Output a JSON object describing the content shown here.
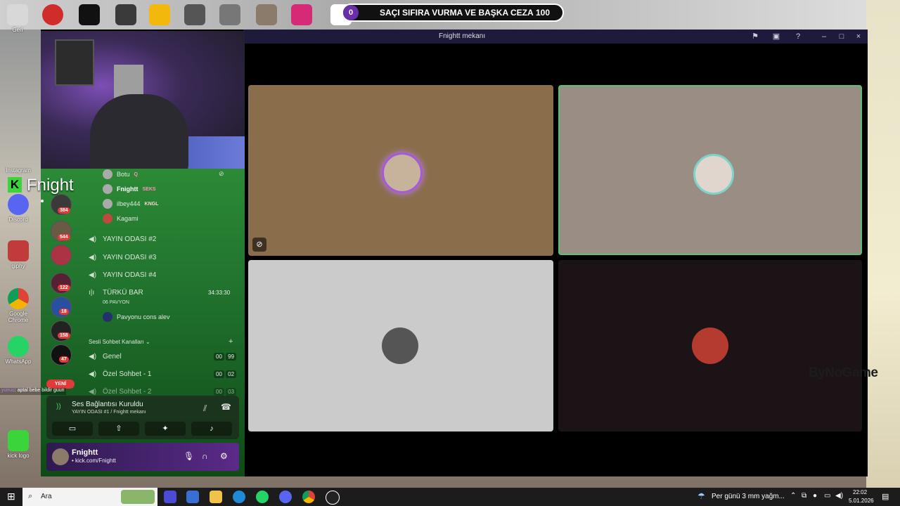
{
  "desktop": {
    "top_icons": [
      "Geri",
      "Instagram"
    ],
    "left_icons": [
      {
        "label": "Instagram",
        "icon": "instagram-icon"
      },
      {
        "label": "Discord",
        "icon": "discord-icon"
      },
      {
        "label": "giphy",
        "icon": "giphy-icon"
      },
      {
        "label": "Google Chrome",
        "icon": "chrome-icon"
      },
      {
        "label": "WhatsApp",
        "icon": "whatsapp-icon"
      },
      {
        "label": "kick logo",
        "icon": "kick-icon"
      }
    ]
  },
  "goal": {
    "current": "0",
    "text": "SAÇI SIFIRA VURMA VE BAŞKA CEZA",
    "target": "100"
  },
  "stream_overlay": {
    "channel_name": "Fnight",
    "sponsor": "ByNoGame"
  },
  "chat": {
    "user": "yunus",
    "message": ": aptal bebe bildir guun"
  },
  "discord_window": {
    "title": "Fnightt mekanı",
    "title_icons": [
      "flag-icon",
      "popout-icon",
      "help-icon",
      "minimize-icon",
      "maximize-icon",
      "close-icon"
    ]
  },
  "server_list": {
    "badges": [
      "384",
      "544",
      "122",
      "18",
      "158",
      "47"
    ],
    "new_label": "YENİ"
  },
  "voice_members": [
    {
      "name": "Botu",
      "tag": "Q"
    },
    {
      "name": "Fnightt",
      "tag": "SEKS"
    },
    {
      "name": "ilbey444",
      "tag": "KNGL"
    },
    {
      "name": "Kagami",
      "tag": ""
    }
  ],
  "channels": {
    "yayin": [
      "YAYIN ODASI #2",
      "YAYIN ODASI #3",
      "YAYIN ODASI #4"
    ],
    "turku_bar": {
      "name": "TÜRKÜ BAR",
      "timer": "34:33:30",
      "sub": "06 PAVYON",
      "member": "Pavyonu cons alev"
    },
    "category": "Sesli Sohbet Kanalları",
    "sesli": [
      {
        "name": "Genel",
        "a": "00",
        "b": "99"
      },
      {
        "name": "Özel Sohbet - 1",
        "a": "00",
        "b": "02"
      },
      {
        "name": "Özel Sohbet - 2",
        "a": "00",
        "b": "03"
      }
    ]
  },
  "voice_panel": {
    "status": "Ses Bağlantısı Kuruldu",
    "sub": "YAYIN ODASI #1 / Fnightt mekanı"
  },
  "user_panel": {
    "name": "Fnightt",
    "sub": "• kick.com/Fnightt"
  },
  "taskbar": {
    "search_label": "Ara",
    "weather": "Per günü 3 mm yağm...",
    "time": "22:02",
    "date": "5.01.2026"
  },
  "colors": {
    "discord_titlebar": "#1e1a3b",
    "speaking_outline": "#5bbd73",
    "avatar_ring_purple": "#a45bd8",
    "panel_green": "#2c8a36",
    "badge_red": "#e03b3b"
  }
}
